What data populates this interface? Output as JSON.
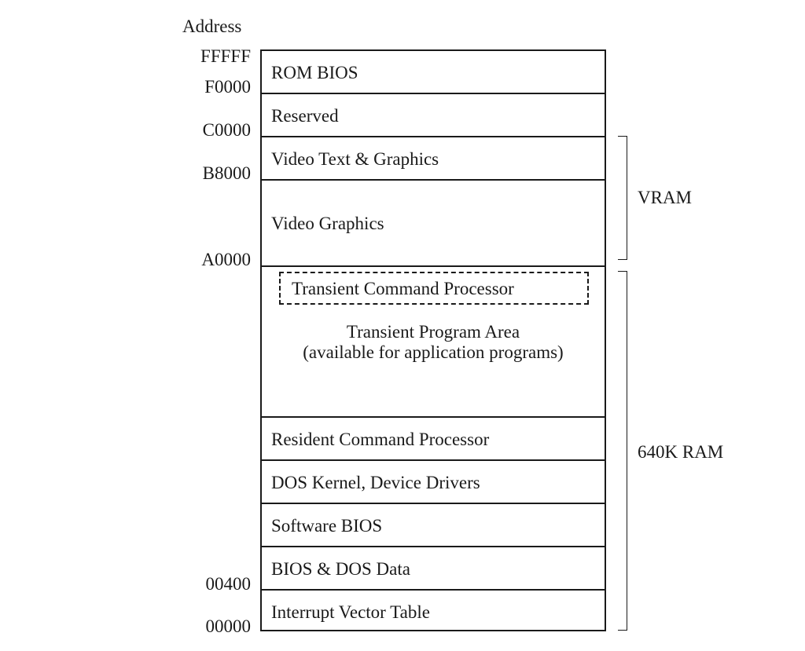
{
  "header": {
    "address_label": "Address"
  },
  "addresses": {
    "fffff": "FFFFF",
    "f0000": "F0000",
    "c0000": "C0000",
    "b8000": "B8000",
    "a0000": "A0000",
    "a00400": "00400",
    "a00000": "00000"
  },
  "regions": {
    "rom_bios": "ROM BIOS",
    "reserved": "Reserved",
    "video_text_graphics": "Video Text & Graphics",
    "video_graphics": "Video Graphics",
    "transient_command_processor": "Transient Command Processor",
    "transient_program_area": "Transient Program Area",
    "transient_program_area_note": "(available for application programs)",
    "resident_command_processor": "Resident Command Processor",
    "dos_kernel": "DOS Kernel, Device Drivers",
    "software_bios": "Software BIOS",
    "bios_dos_data": "BIOS & DOS Data",
    "interrupt_vector_table": "Interrupt Vector Table"
  },
  "brackets": {
    "vram": "VRAM",
    "ram_640k": "640K RAM"
  }
}
